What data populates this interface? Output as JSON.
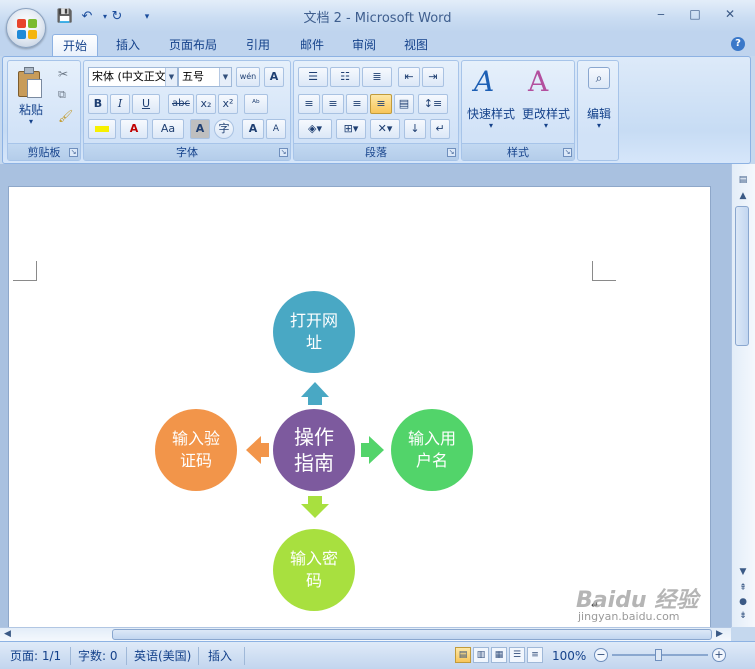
{
  "window": {
    "title": "文档 2 - Microsoft Word",
    "minimize": "‒",
    "maximize": "□",
    "close": "✕"
  },
  "quick_access": {
    "save_icon": "save-icon",
    "undo_icon": "undo-icon",
    "redo_icon": "redo-icon",
    "customize_icon": "customize-icon"
  },
  "tabs": [
    {
      "label": "开始",
      "active": true
    },
    {
      "label": "插入"
    },
    {
      "label": "页面布局"
    },
    {
      "label": "引用"
    },
    {
      "label": "邮件"
    },
    {
      "label": "审阅"
    },
    {
      "label": "视图"
    }
  ],
  "ribbon": {
    "clipboard": {
      "label": "剪贴板",
      "paste": "粘贴"
    },
    "font": {
      "label": "字体",
      "font_name": "宋体 (中文正文)",
      "font_size": "五号",
      "phonetic": "wén",
      "bold": "B",
      "italic": "I",
      "underline": "U",
      "strike": "abc",
      "subscript": "x₂",
      "superscript": "x²",
      "font_color": "A",
      "case": "Aa",
      "shade": "A",
      "grow": "A",
      "shrink": "A"
    },
    "paragraph": {
      "label": "段落"
    },
    "styles": {
      "label": "样式",
      "quick": "快速样式",
      "change": "更改样式"
    },
    "editing": {
      "label": "编辑"
    }
  },
  "diagram": {
    "center": {
      "lines": [
        "操作",
        "指南"
      ],
      "color": "#7d5a9e"
    },
    "top": {
      "lines": [
        "打开网",
        "址"
      ],
      "color": "#49a8c4"
    },
    "right": {
      "lines": [
        "输入用",
        "户名"
      ],
      "color": "#52d46a"
    },
    "bottom": {
      "lines": [
        "输入密",
        "码"
      ],
      "color": "#a8e03f"
    },
    "left": {
      "lines": [
        "输入验",
        "证码"
      ],
      "color": "#f2954a"
    }
  },
  "statusbar": {
    "page": "页面: 1/1",
    "words": "字数: 0",
    "language": "英语(美国)",
    "mode": "插入",
    "zoom": "100%"
  },
  "watermark": {
    "brand": "Baidu 经验",
    "url": "jingyan.baidu.com"
  }
}
